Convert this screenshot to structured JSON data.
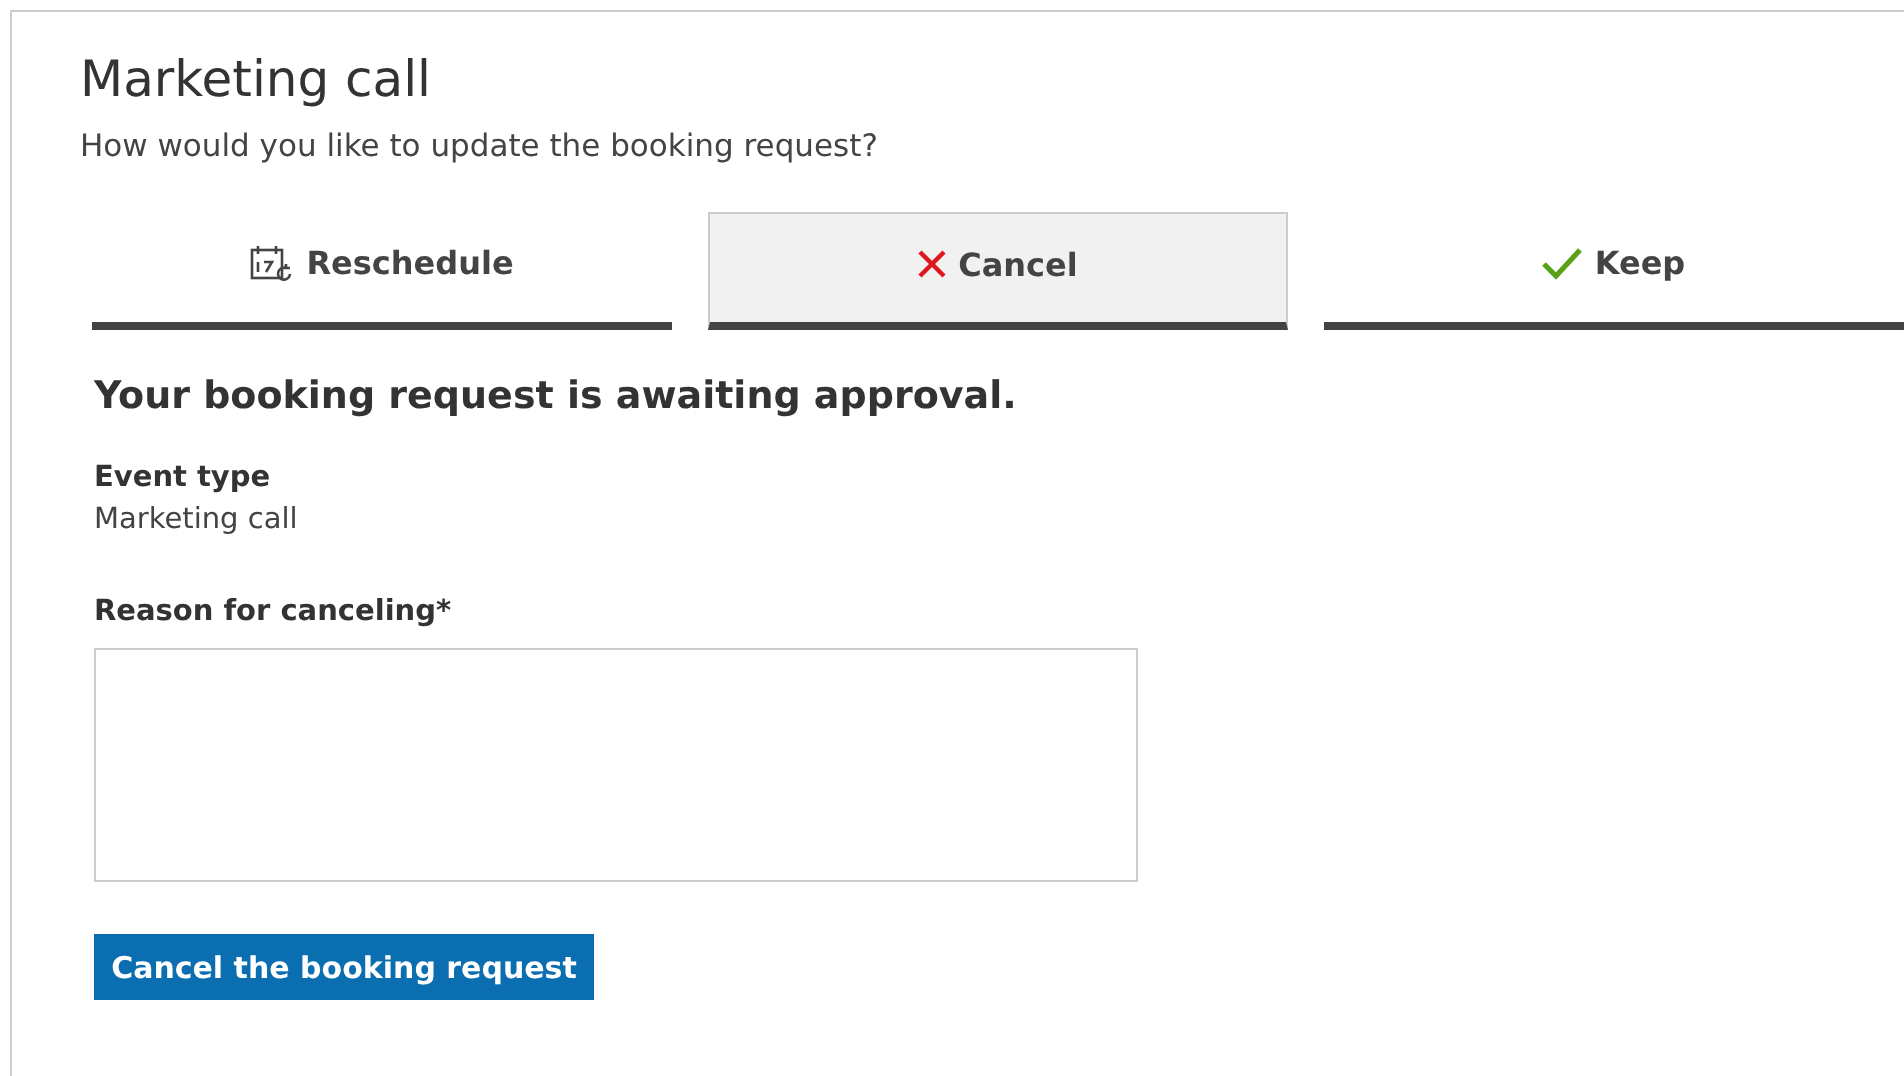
{
  "title": "Marketing call",
  "subtitle": "How would you like to update the booking request?",
  "tabs": [
    {
      "label": "Reschedule",
      "kind": "calendar",
      "selected": false
    },
    {
      "label": "Cancel",
      "kind": "cross",
      "selected": true
    },
    {
      "label": "Keep",
      "kind": "check",
      "selected": false
    }
  ],
  "status": "Your booking request is awaiting approval.",
  "event": {
    "label": "Event type",
    "value": "Marketing call"
  },
  "reason": {
    "label": "Reason for canceling*"
  },
  "submit": "Cancel the booking request"
}
